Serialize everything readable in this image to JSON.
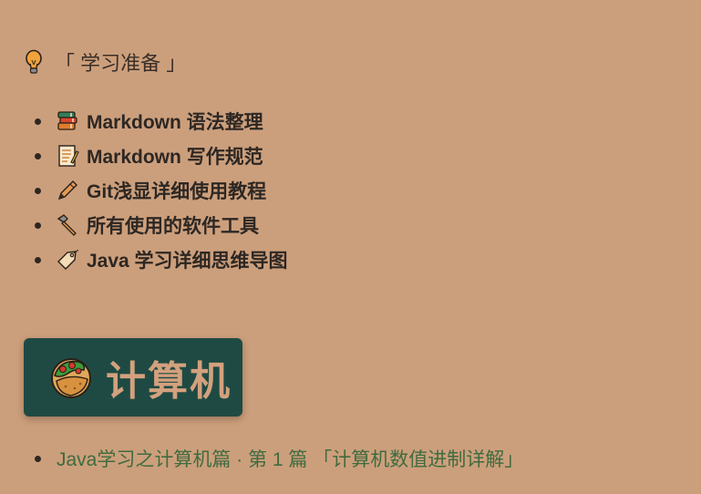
{
  "section": {
    "title": "「 学习准备 」",
    "icon": "lightbulb-icon"
  },
  "prep_items": [
    {
      "icon": "books-icon",
      "label": "Markdown 语法整理"
    },
    {
      "icon": "memo-icon",
      "label": "Markdown 写作规范"
    },
    {
      "icon": "pen-icon",
      "label": "Git浅显详细使用教程"
    },
    {
      "icon": "hammer-icon",
      "label": "所有使用的软件工具"
    },
    {
      "icon": "label-tag-icon",
      "label": "Java 学习详细思维导图"
    }
  ],
  "badge": {
    "icon": "taco-icon",
    "text": "计算机",
    "background": "#1f4a44",
    "text_color": "#d3a17d"
  },
  "articles": [
    {
      "label": "Java学习之计算机篇 · 第 1 篇 「计算机数值进制详解」"
    }
  ],
  "colors": {
    "page_background": "#cc9f7c",
    "link": "#3f6b3f"
  }
}
